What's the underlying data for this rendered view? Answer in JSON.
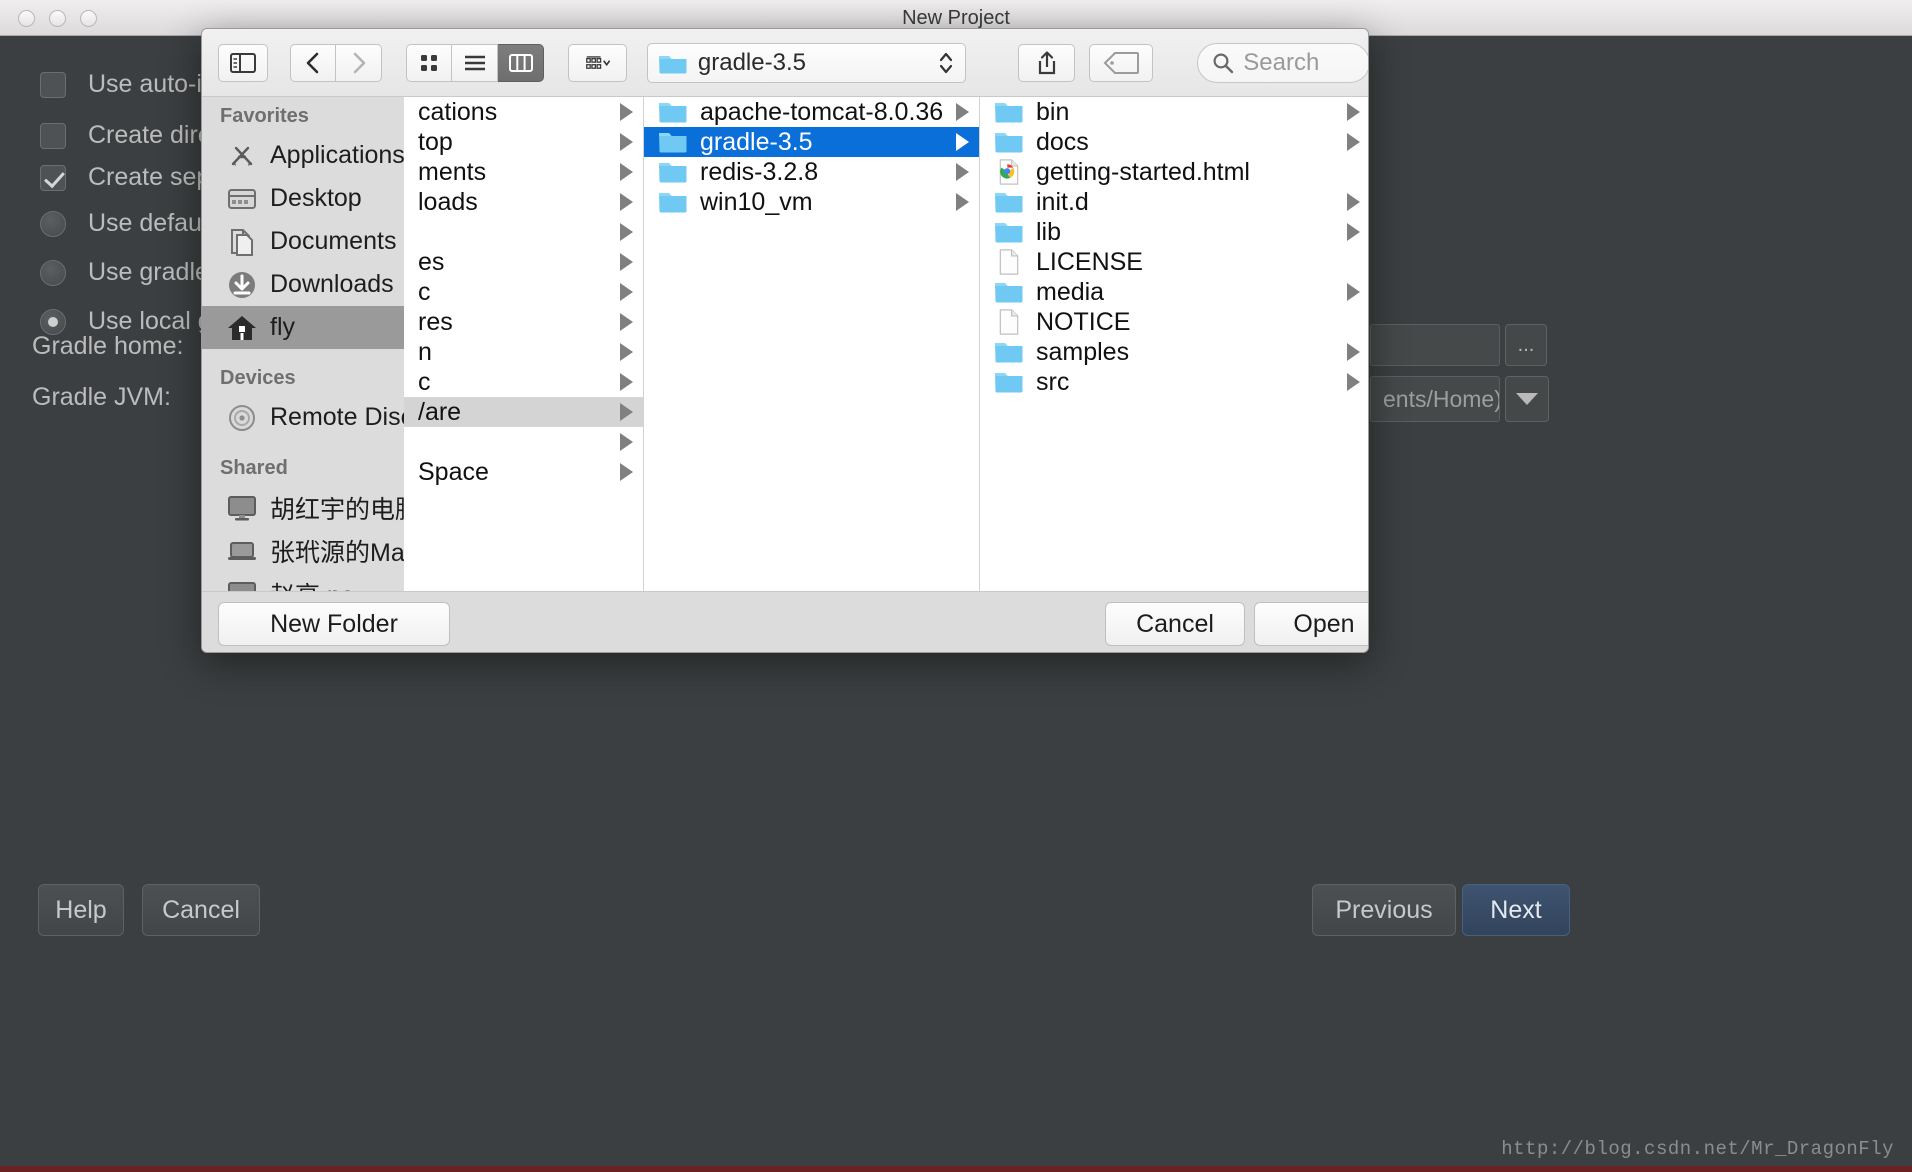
{
  "window": {
    "title": "New Project",
    "traffic_lights": [
      "close",
      "minimize",
      "zoom"
    ]
  },
  "ide": {
    "options": [
      {
        "type": "checkbox",
        "checked": false,
        "label": "Use auto-imp"
      },
      {
        "type": "checkbox",
        "checked": false,
        "label": "Create direct"
      },
      {
        "type": "checkbox",
        "checked": true,
        "label": "Create separ"
      },
      {
        "type": "radio",
        "checked": false,
        "label": "Use default g"
      },
      {
        "type": "radio",
        "checked": false,
        "label": "Use gradle w"
      },
      {
        "type": "radio",
        "checked": true,
        "label": "Use local gra"
      }
    ],
    "fields": [
      {
        "label": "Gradle home:"
      },
      {
        "label": "Gradle JVM:"
      }
    ],
    "gradle_home_value": "",
    "gradle_home_browse": "...",
    "gradle_jvm_value": "ents/Home)",
    "footer": {
      "help": "Help",
      "cancel": "Cancel",
      "previous": "Previous",
      "next": "Next"
    },
    "watermark": "http://blog.csdn.net/Mr_DragonFly"
  },
  "finder": {
    "toolbar": {
      "sidebar_toggle": "sidebar-toggle-icon",
      "back": "back-icon",
      "forward": "forward-icon",
      "view_icon": "icon-view",
      "view_list": "list-view",
      "view_column": "column-view",
      "arrange": "arrange-icon",
      "path_label": "gradle-3.5",
      "share": "share-icon",
      "tag": "tag-icon",
      "search_placeholder": "Search"
    },
    "sidebar": {
      "sections": [
        {
          "header": "Favorites",
          "items": [
            {
              "label": "Applications",
              "icon": "applications-icon",
              "selected": false
            },
            {
              "label": "Desktop",
              "icon": "desktop-icon",
              "selected": false
            },
            {
              "label": "Documents",
              "icon": "documents-icon",
              "selected": false
            },
            {
              "label": "Downloads",
              "icon": "downloads-icon",
              "selected": false
            },
            {
              "label": "fly",
              "icon": "home-icon",
              "selected": true
            }
          ]
        },
        {
          "header": "Devices",
          "items": [
            {
              "label": "Remote Disc",
              "icon": "disc-icon",
              "selected": false
            }
          ]
        },
        {
          "header": "Shared",
          "items": [
            {
              "label": "胡红宇的电脑",
              "icon": "display-icon",
              "selected": false
            },
            {
              "label": "张玳源的MacB...",
              "icon": "laptop-icon",
              "selected": false
            },
            {
              "label": "赵高 pc",
              "icon": "display-icon",
              "selected": false
            }
          ]
        }
      ]
    },
    "columns": [
      {
        "name": "home-column",
        "rows": [
          {
            "label": "cations",
            "caret": true,
            "kind": "folder-clipped",
            "state": "none"
          },
          {
            "label": "top",
            "caret": true,
            "kind": "folder-clipped",
            "state": "none"
          },
          {
            "label": "ments",
            "caret": true,
            "kind": "folder-clipped",
            "state": "none"
          },
          {
            "label": "loads",
            "caret": true,
            "kind": "folder-clipped",
            "state": "none"
          },
          {
            "label": "",
            "caret": true,
            "kind": "folder-clipped",
            "state": "none"
          },
          {
            "label": "es",
            "caret": true,
            "kind": "folder-clipped",
            "state": "none"
          },
          {
            "label": "c",
            "caret": true,
            "kind": "folder-clipped",
            "state": "none"
          },
          {
            "label": "res",
            "caret": true,
            "kind": "folder-clipped",
            "state": "none"
          },
          {
            "label": "n",
            "caret": true,
            "kind": "folder-clipped",
            "state": "none"
          },
          {
            "label": "c",
            "caret": true,
            "kind": "folder-clipped",
            "state": "none"
          },
          {
            "label": "/are",
            "caret": true,
            "kind": "folder-clipped",
            "state": "selected-inactive"
          },
          {
            "label": "",
            "caret": true,
            "kind": "folder-clipped",
            "state": "none"
          },
          {
            "label": "Space",
            "caret": true,
            "kind": "folder-clipped",
            "state": "none"
          }
        ]
      },
      {
        "name": "software-column",
        "rows": [
          {
            "label": "apache-tomcat-8.0.36",
            "caret": true,
            "kind": "folder",
            "state": "none"
          },
          {
            "label": "gradle-3.5",
            "caret": true,
            "kind": "folder",
            "state": "selected-active"
          },
          {
            "label": "redis-3.2.8",
            "caret": true,
            "kind": "folder",
            "state": "none"
          },
          {
            "label": "win10_vm",
            "caret": true,
            "kind": "folder",
            "state": "none"
          }
        ]
      },
      {
        "name": "gradle-column",
        "rows": [
          {
            "label": "bin",
            "caret": true,
            "kind": "folder",
            "state": "none"
          },
          {
            "label": "docs",
            "caret": true,
            "kind": "folder",
            "state": "none"
          },
          {
            "label": "getting-started.html",
            "caret": false,
            "kind": "chrome",
            "state": "none"
          },
          {
            "label": "init.d",
            "caret": true,
            "kind": "folder",
            "state": "none"
          },
          {
            "label": "lib",
            "caret": true,
            "kind": "folder",
            "state": "none"
          },
          {
            "label": "LICENSE",
            "caret": false,
            "kind": "document",
            "state": "none"
          },
          {
            "label": "media",
            "caret": true,
            "kind": "folder",
            "state": "none"
          },
          {
            "label": "NOTICE",
            "caret": false,
            "kind": "document",
            "state": "none"
          },
          {
            "label": "samples",
            "caret": true,
            "kind": "folder",
            "state": "none"
          },
          {
            "label": "src",
            "caret": true,
            "kind": "folder",
            "state": "none"
          }
        ]
      }
    ],
    "footer": {
      "new_folder": "New Folder",
      "cancel": "Cancel",
      "open": "Open"
    }
  },
  "colors": {
    "selection_blue": "#0a6fd8",
    "folder_blue": "#6fc9f2",
    "ide_bg": "#3c3f41",
    "panel_bg": "#ececec",
    "sidebar_bg": "#dcdcdc"
  }
}
